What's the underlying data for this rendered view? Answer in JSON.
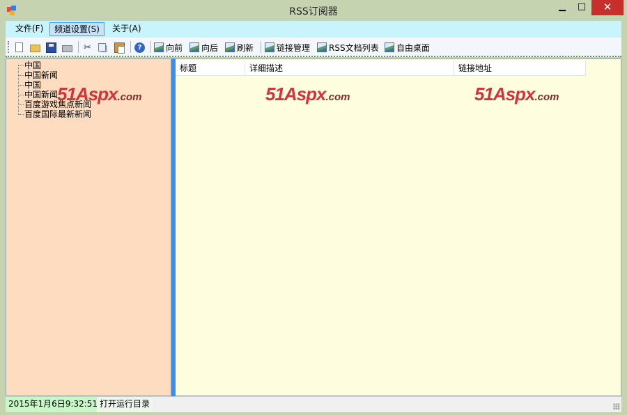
{
  "window": {
    "title": "RSS订阅器",
    "minimize_glyph": "▁",
    "maximize_glyph": "□",
    "close_glyph": "✕"
  },
  "menu": {
    "items": [
      "文件(F)",
      "频道设置(S)",
      "关于(A)"
    ],
    "active_index": 1
  },
  "toolbar": {
    "icons": [
      "new-file-icon",
      "open-folder-icon",
      "save-icon",
      "print-icon",
      "cut-icon",
      "copy-icon",
      "paste-icon",
      "help-icon"
    ],
    "buttons": [
      "向前",
      "向后",
      "刷新",
      "链接管理",
      "RSS文档列表",
      "自由桌面"
    ]
  },
  "tree": {
    "items": [
      "中国",
      "中国新闻",
      "中国",
      "中国新闻",
      "百度游戏焦点新闻",
      "百度国际最新新闻"
    ]
  },
  "list": {
    "columns": [
      "标题",
      "详细描述",
      "链接地址"
    ],
    "rows": []
  },
  "watermark": {
    "main": "51Aspx",
    "sub": ".com"
  },
  "status": {
    "datetime": "2015年1月6日9:32:51",
    "link": "打开运行目录"
  },
  "colors": {
    "frame": "#c5d3b0",
    "menubar": "#c8f4fc",
    "left_pane": "#fddcc0",
    "right_pane": "#fefedf",
    "splitter": "#3b8fe6",
    "status_date": "#c8f7c8",
    "close_button": "#c7302a",
    "logo": "#d5323a"
  }
}
